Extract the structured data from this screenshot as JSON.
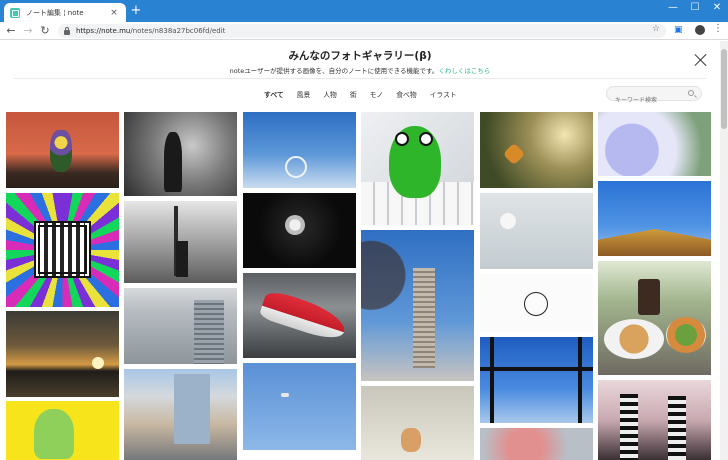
{
  "browser": {
    "tab_title": "ノート編集 ¦ note",
    "new_tab_label": "+",
    "url_host": "https://note.mu",
    "url_path": "/notes/n838a27bc06fd/edit",
    "minimize": "—",
    "maximize": "☐",
    "close": "✕",
    "back": "←",
    "forward": "→",
    "reload": "↻",
    "star": "☆",
    "menu": "⋮",
    "tab_close": "×"
  },
  "gallery": {
    "title": "みんなのフォトギャラリー(β)",
    "subtitle": "noteユーザーが提供する画像を、自分のノートに使用できる機能です。",
    "more_link": "くわしくはこちら",
    "categories": [
      "すべて",
      "風景",
      "人物",
      "街",
      "モノ",
      "食べ物",
      "イラスト"
    ],
    "active_category": "すべて",
    "search_placeholder": "キーワード検索"
  },
  "photos": [
    {
      "name": "photo-flower-arrangement"
    },
    {
      "name": "photo-glitch-art"
    },
    {
      "name": "photo-sunset-sea"
    },
    {
      "name": "photo-cartoon-cat"
    },
    {
      "name": "photo-shadow-on-grass"
    },
    {
      "name": "photo-bw-street"
    },
    {
      "name": "photo-city-buildings"
    },
    {
      "name": "photo-street-houses"
    },
    {
      "name": "photo-ferris-wheel"
    },
    {
      "name": "photo-white-flower-dark"
    },
    {
      "name": "photo-bullet-train"
    },
    {
      "name": "photo-blue-sky-bird"
    },
    {
      "name": "photo-frog-keyboard"
    },
    {
      "name": "photo-tower-cherry"
    },
    {
      "name": "photo-cat-snow"
    },
    {
      "name": "photo-butterfly-sunlight"
    },
    {
      "name": "photo-white-blossom"
    },
    {
      "name": "photo-doodle-drawing"
    },
    {
      "name": "photo-bridge-blue"
    },
    {
      "name": "photo-pink-blossom"
    },
    {
      "name": "photo-hydrangea"
    },
    {
      "name": "photo-shrine-roof"
    },
    {
      "name": "photo-food-coffee"
    },
    {
      "name": "photo-people-shop"
    }
  ]
}
